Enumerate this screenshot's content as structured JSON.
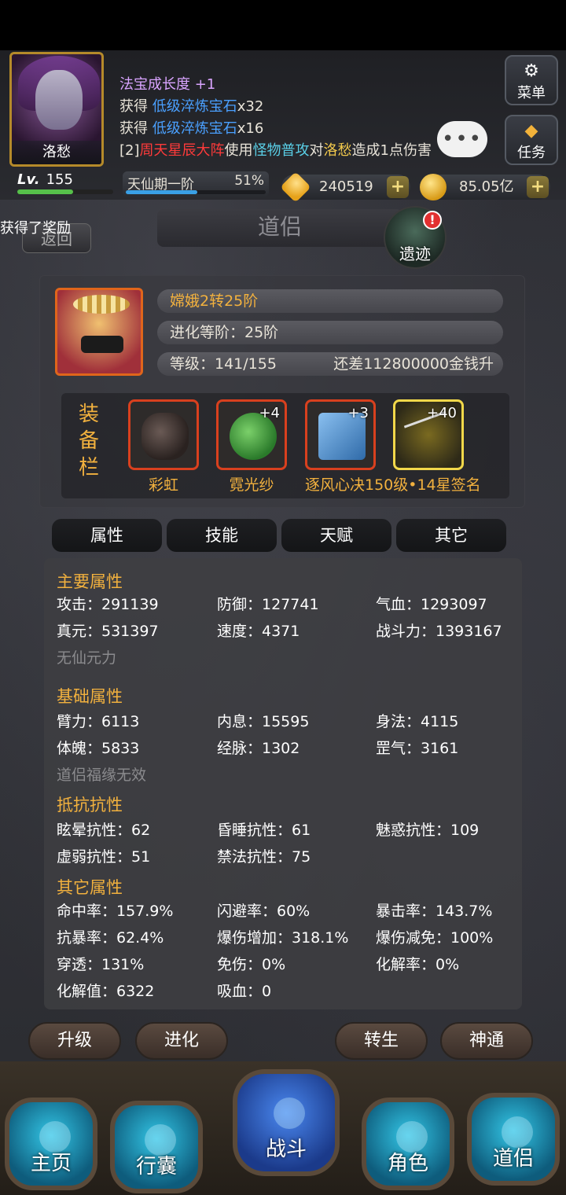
{
  "player": {
    "name": "洛愁",
    "level_label": "Lv.",
    "level": "155",
    "realm": "天仙期一阶",
    "realm_percent": "51%"
  },
  "log": {
    "line1_a": "法宝成长度",
    "line1_b": " +1",
    "line2_a": "获得 ",
    "line2_item": "低级淬炼宝石",
    "line2_qty": "x32",
    "line3_a": "获得 ",
    "line3_item": "低级淬炼宝石",
    "line3_qty": "x16",
    "line4_a": "[2]",
    "line4_b": "周天星辰大阵",
    "line4_c": "使用",
    "line4_d": "怪物普攻",
    "line4_e": "对",
    "line4_f": "洛愁",
    "line4_g": "造成1点伤害"
  },
  "chat_bubble": "•••",
  "side": {
    "menu": "菜单",
    "task": "任务"
  },
  "currency": {
    "gems": "240519",
    "gold": "85.05亿",
    "plus": "+"
  },
  "notice": "获得了奖励",
  "nav": {
    "back": "返回",
    "title": "道侣",
    "relic": "遗迹",
    "relic_badge": "!"
  },
  "partner": {
    "name_line": "嫦娥2转25阶",
    "evolution": "进化等阶：25阶",
    "level": "等级：141/155",
    "upgrade_cost": "还差112800000金钱升"
  },
  "equipment": {
    "label": [
      "装",
      "备",
      "栏"
    ],
    "slots": [
      {
        "name": "彩虹",
        "level": ""
      },
      {
        "name": "霓光纱",
        "level": "+4"
      },
      {
        "name": "逐风心决150级•14星签名",
        "level": "+3"
      },
      {
        "name": "",
        "level": "+40"
      }
    ]
  },
  "tabs": [
    "属性",
    "技能",
    "天赋",
    "其它"
  ],
  "attributes": {
    "main_title": "主要属性",
    "main": [
      "攻击：291139",
      "防御：127741",
      "气血：1293097",
      "真元：531397",
      "速度：4371",
      "战斗力：1393167"
    ],
    "main_note": "无仙元力",
    "base_title": "基础属性",
    "base": [
      "臂力：6113",
      "内息：15595",
      "身法：4115",
      "体魄：5833",
      "经脉：1302",
      "罡气：3161"
    ],
    "base_note": "道侣福缘无效",
    "resist_title": "抵抗抗性",
    "resist": [
      "眩晕抗性：62",
      "昏睡抗性：61",
      "魅惑抗性：109",
      "虚弱抗性：51",
      "禁法抗性：75"
    ],
    "other_title": "其它属性",
    "other": [
      "命中率：157.9%",
      "闪避率：60%",
      "暴击率：143.7%",
      "抗暴率：62.4%",
      "爆伤增加：318.1%",
      "爆伤减免：100%",
      "穿透：131%",
      "免伤：0%",
      "化解率：0%",
      "化解值：6322",
      "吸血：0"
    ]
  },
  "actions": [
    "升级",
    "进化",
    "转生",
    "神通"
  ],
  "bottom_nav": [
    "主页",
    "行囊",
    "战斗",
    "角色",
    "道侣"
  ],
  "colors": {
    "accent_gold": "#f2b13e",
    "item_blue": "#4aa0ff",
    "danger_red": "#ff3a3a"
  }
}
